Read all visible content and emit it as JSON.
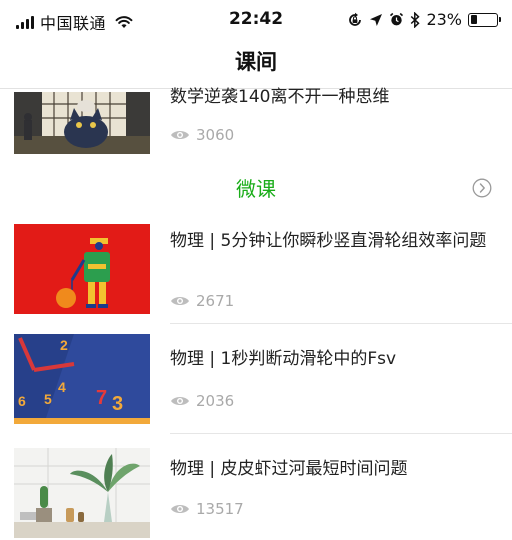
{
  "status_bar": {
    "carrier": "中国联通",
    "time": "22:42",
    "battery": "23%",
    "battery_level": 0.23
  },
  "nav": {
    "title": "课间"
  },
  "top_item": {
    "title": "数学逆袭140离不开一种思维",
    "views": "3060",
    "icon": "eye-icon"
  },
  "section": {
    "title": "微课",
    "more_icon": "chevron-right-circle-icon",
    "accent": "#1aad19"
  },
  "items": [
    {
      "title": "物理 | 5分钟让你瞬秒竖直滑轮组效率问题",
      "views": "2671"
    },
    {
      "title": "物理 | 1秒判断动滑轮中的Fsv",
      "views": "2036"
    },
    {
      "title": "物理 | 皮皮虾过河最短时间问题",
      "views": "13517"
    }
  ]
}
